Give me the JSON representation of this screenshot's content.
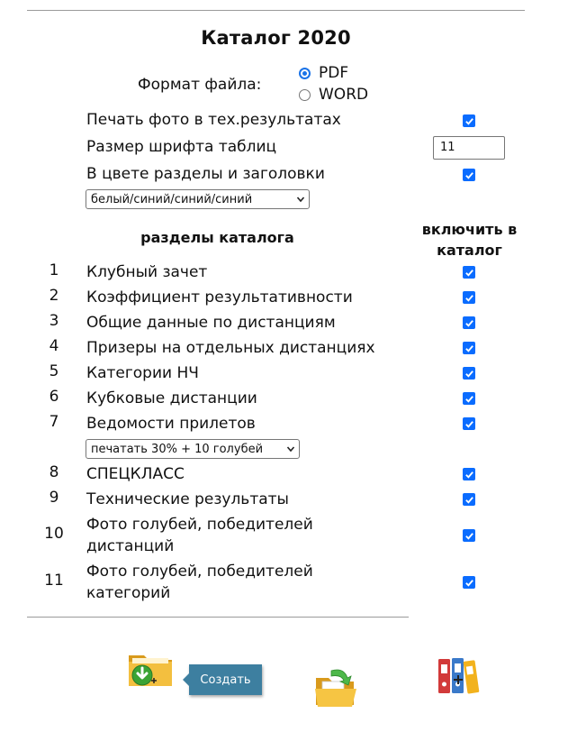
{
  "title": "Каталог 2020",
  "format": {
    "label": "Формат файла:",
    "options": [
      {
        "label": "PDF",
        "selected": true
      },
      {
        "label": "WORD",
        "selected": false
      }
    ]
  },
  "settings": {
    "print_photos": {
      "label": "Печать фото в тех.результатах",
      "checked": true
    },
    "font_size": {
      "label": "Размер шрифта таблиц",
      "value": "11"
    },
    "color_sections": {
      "label": "В цвете разделы и заголовки",
      "checked": true
    },
    "color_scheme": {
      "value": "белый/синий/синий/синий"
    }
  },
  "headers": {
    "sections": "разделы каталога",
    "include_line1": "включить в",
    "include_line2": "каталог"
  },
  "sections": [
    {
      "num": "1",
      "label": "Клубный зачет",
      "checked": true
    },
    {
      "num": "2",
      "label": "Коэффициент результативности",
      "checked": true
    },
    {
      "num": "3",
      "label": "Общие данные по дистанциям",
      "checked": true
    },
    {
      "num": "4",
      "label": "Призеры на отдельных дистанциях",
      "checked": true
    },
    {
      "num": "5",
      "label": "Категории НЧ",
      "checked": true
    },
    {
      "num": "6",
      "label": "Кубковые дистанции",
      "checked": true
    },
    {
      "num": "7",
      "label": "Ведомости прилетов",
      "checked": true,
      "select": "печатать 30% + 10 голубей"
    },
    {
      "num": "8",
      "label": "СПЕЦКЛАСС",
      "checked": true
    },
    {
      "num": "9",
      "label": "Технические результаты",
      "checked": true
    },
    {
      "num": "10",
      "label_line1": "Фото голубей, победителей",
      "label_line2": "дистанций",
      "checked": true
    },
    {
      "num": "11",
      "label_line1": "Фото голубей, победителей",
      "label_line2": "категорий",
      "checked": true
    }
  ],
  "footer": {
    "tooltip": "Создать",
    "icons": [
      "folder-download-icon",
      "folder-open-icon",
      "binders-add-icon"
    ]
  },
  "colors": {
    "accent": "#0a6cff",
    "tooltip_bg": "#3d7fa0",
    "folder": "#f0b429",
    "download": "#3aa335"
  }
}
